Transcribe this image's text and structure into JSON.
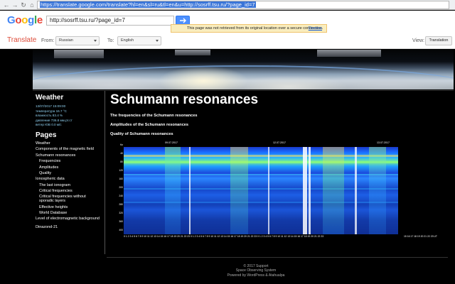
{
  "browser": {
    "url": "https://translate.google.com/translate?hl=en&sl=ru&tl=en&u=http://sosrff.tsu.ru/?page_id=7"
  },
  "translate_bar": {
    "logo": [
      "G",
      "o",
      "o",
      "g",
      "l",
      "e"
    ],
    "url_input": "http://sosrff.tsu.ru/?page_id=7",
    "notice": "This page was not retrieved from its original location over a secure connection.",
    "dismiss": "Dismiss",
    "translate_label": "Translate",
    "from_label": "From:",
    "from_value": "Russian",
    "to_label": "To:",
    "to_value": "English",
    "view_label": "View:",
    "view_value": "Translation"
  },
  "sidebar": {
    "weather_title": "Weather",
    "weather_lines": [
      "13/07/2017 15:09:00",
      "температура 16.7 °C",
      "влажность 83.4 %",
      "давление 736.8 мм.рт.ст",
      "ветер ЮВ 0.0 м/с"
    ],
    "pages_title": "Pages",
    "nav": [
      {
        "label": "Weather",
        "level": 0
      },
      {
        "label": "Components of the magnetic field",
        "level": 0
      },
      {
        "label": "Schumann resonances",
        "level": 0
      },
      {
        "label": "Frequencies",
        "level": 1
      },
      {
        "label": "Amplitudes",
        "level": 1
      },
      {
        "label": "Quality",
        "level": 1
      },
      {
        "label": "Ionospheric data",
        "level": 0
      },
      {
        "label": "The last ionogram",
        "level": 1
      },
      {
        "label": "Critical frequencies",
        "level": 1
      },
      {
        "label": "Critical frequencies without sporadic layers",
        "level": 1
      },
      {
        "label": "Effective heights",
        "level": 1
      },
      {
        "label": "World Database",
        "level": 1
      },
      {
        "label": "Level of electromagnetic background",
        "level": 0
      },
      {
        "label": "Dinazond-21",
        "level": 0
      }
    ]
  },
  "main": {
    "title": "Schumann resonances",
    "links": [
      "The frequencies of the Schumann resonances",
      "Amplitudes of the Schumann resonances",
      "Quality of Schumann resonances"
    ],
    "spectrogram": {
      "dates": [
        "09.07.2017",
        "12.07.2017",
        "13.07.2017"
      ],
      "y_labels": [
        "Hz",
        "40",
        "80",
        "120",
        "160",
        "200",
        "240",
        "280",
        "320",
        "360",
        "400"
      ],
      "x_labels": "0 1 2 3 4 5 6 7 8 9 10 11 12 13 14 15 16 17 18 19 20 21 22 23 0 1 2 3 4 5 6 7 8 9 10 11 12 13 14 15 16 17 18 19 20 21 22 23 0 1 2 3 4 5 6 7 8 9 10 11 12 13 14 15 16 17 18 19 20 21 22 23",
      "x_labels_ext": "15 16 17 18 19 20 21 22 23 UT"
    }
  },
  "footer": {
    "line1": "© 2017 Support",
    "line2": "Space Observing System",
    "line3": "Powered by WordPress & Atahualpa"
  }
}
